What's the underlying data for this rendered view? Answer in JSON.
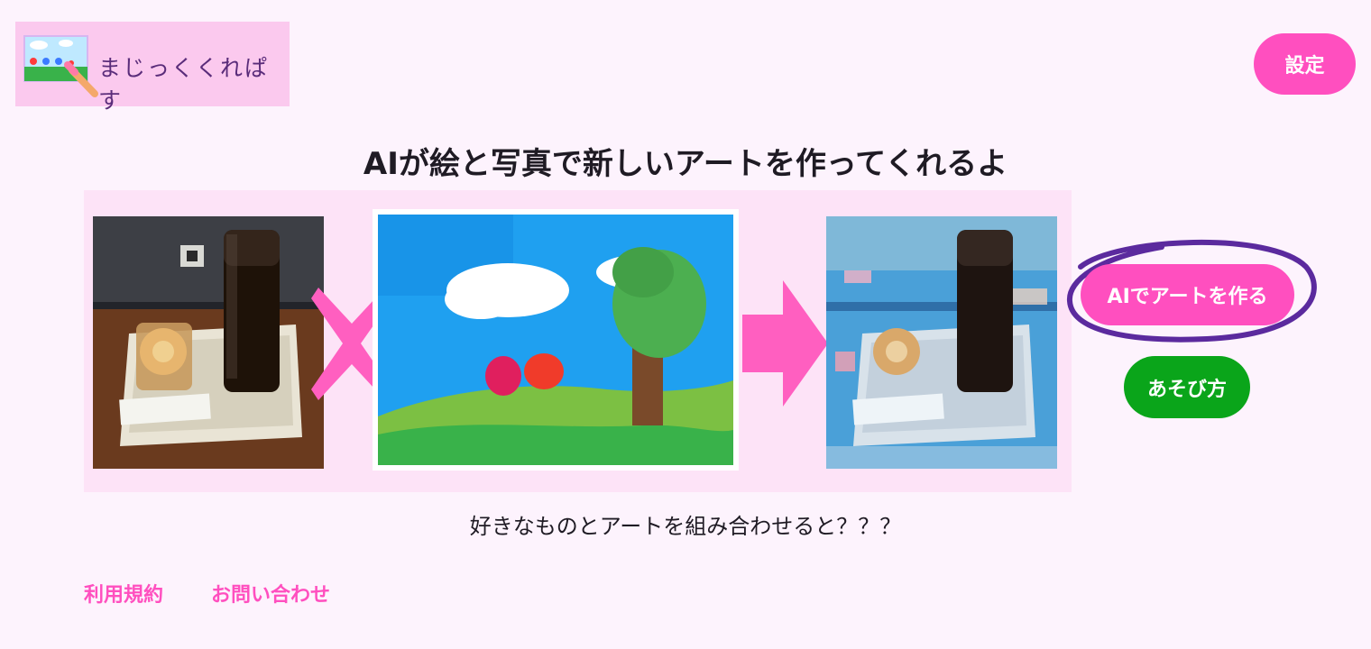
{
  "app": {
    "logo_text": "まじっくくれぱす",
    "settings_label": "設定"
  },
  "main": {
    "headline": "AIが絵と写真で新しいアートを作ってくれるよ",
    "tagline": "好きなものとアートを組み合わせると？？？",
    "make_art_label": "AIでアートを作る",
    "how_to_play_label": "あそび方"
  },
  "footer": {
    "terms_label": "利用規約",
    "contact_label": "お問い合わせ"
  },
  "colors": {
    "accent_pink": "#ff4fbf",
    "accent_green": "#0aa51a",
    "highlight_ring": "#5b2a9e",
    "background": "#fdf3fd"
  },
  "icons": [
    "crayon-picture-logo-icon",
    "multiply-cross-icon",
    "right-arrow-icon"
  ]
}
